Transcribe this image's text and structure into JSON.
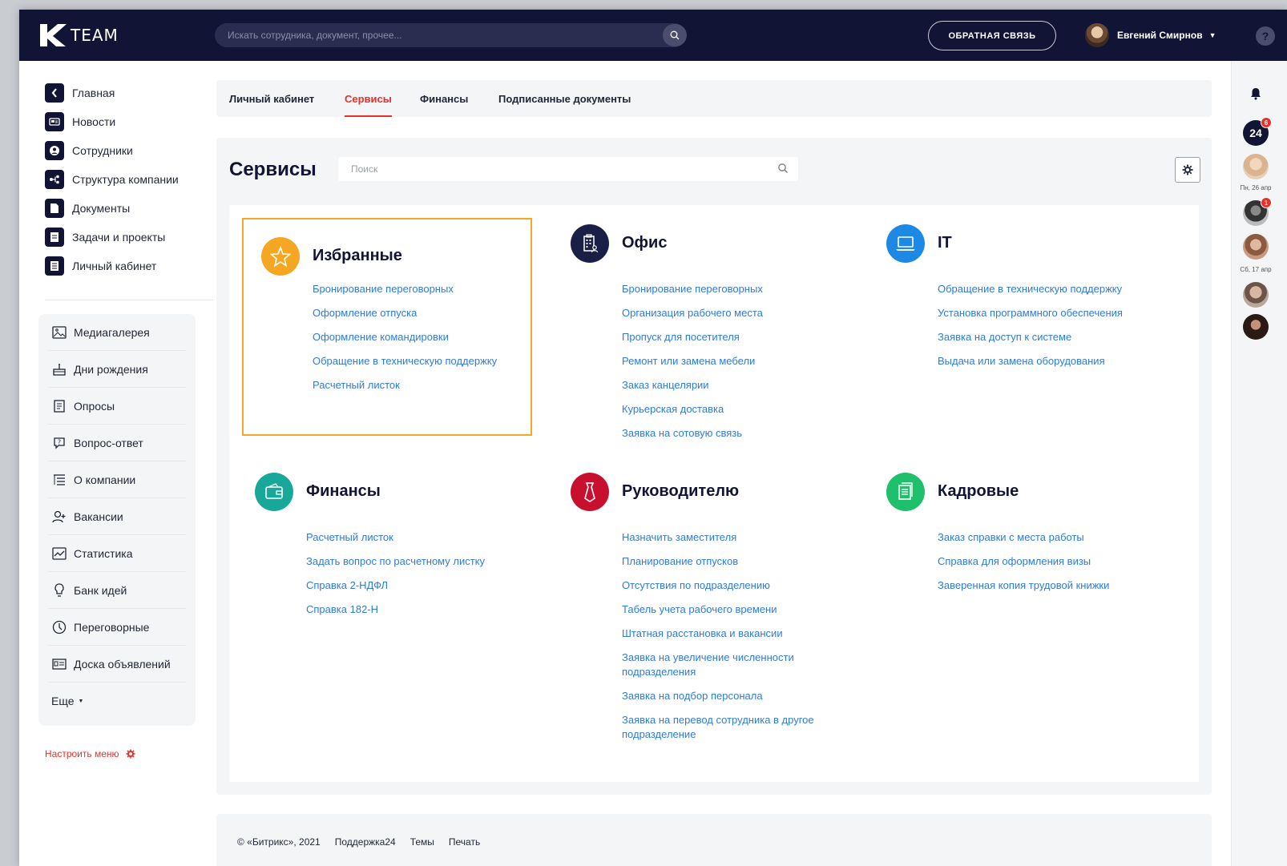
{
  "header": {
    "logo_text": "TEAM",
    "search_placeholder": "Искать сотрудника, документ, прочее...",
    "feedback_label": "ОБРАТНАЯ СВЯЗЬ",
    "user_name": "Евгений Смирнов",
    "help_label": "?"
  },
  "rail": {
    "bitrix_label": "24",
    "bitrix_badge": "6",
    "date1": "Пн, 26 апр",
    "avatar_badge": "1",
    "date2": "Сб, 17 апр"
  },
  "sidebar": {
    "main": [
      "Главная",
      "Новости",
      "Сотрудники",
      "Структура компании",
      "Документы",
      "Задачи и проекты",
      "Личный кабинет"
    ],
    "box": [
      "Медиагалерея",
      "Дни рождения",
      "Опросы",
      "Вопрос-ответ",
      "О компании",
      "Вакансии",
      "Статистика",
      "Банк идей",
      "Переговорные",
      "Доска объявлений"
    ],
    "more": "Еще",
    "customize": "Настроить меню"
  },
  "tabs": [
    "Личный кабинет",
    "Сервисы",
    "Финансы",
    "Подписанные документы"
  ],
  "services": {
    "title": "Сервисы",
    "search_placeholder": "Поиск",
    "categories": [
      {
        "title": "Избранные",
        "color": "#f5a623",
        "icon": "star-icon",
        "items": [
          "Бронирование переговорных",
          "Оформление отпуска",
          "Оформление командировки",
          "Обращение в техническую поддержку",
          "Расчетный листок"
        ]
      },
      {
        "title": "Офис",
        "color": "#1a1f45",
        "icon": "office-building-icon",
        "items": [
          "Бронирование переговорных",
          "Организация рабочего места",
          "Пропуск для посетителя",
          "Ремонт или замена мебели",
          "Заказ канцелярии",
          "Курьерская доставка",
          "Заявка на сотовую связь"
        ]
      },
      {
        "title": "IT",
        "color": "#1e88e5",
        "icon": "laptop-icon",
        "items": [
          "Обращение в техническую поддержку",
          "Установка программного обеспечения",
          "Заявка на доступ к системе",
          "Выдача или замена оборудования"
        ]
      },
      {
        "title": "Финансы",
        "color": "#17a89a",
        "icon": "wallet-icon",
        "items": [
          "Расчетный листок",
          "Задать вопрос по расчетному листку",
          "Справка 2-НДФЛ",
          "Справка 182-Н"
        ]
      },
      {
        "title": "Руководителю",
        "color": "#c8102e",
        "icon": "tie-icon",
        "items": [
          "Назначить заместителя",
          "Планирование отпусков",
          "Отсутствия по подразделению",
          "Табель учета рабочего времени",
          "Штатная расстановка и вакансии",
          "Заявка на увеличение численности подразделения",
          "Заявка на подбор персонала",
          "Заявка на перевод сотрудника в другое подразделение"
        ]
      },
      {
        "title": "Кадровые",
        "color": "#1ec06b",
        "icon": "document-icon",
        "items": [
          "Заказ справки с места работы",
          "Справка для оформления визы",
          "Заверенная копия трудовой книжки"
        ]
      }
    ]
  },
  "footer": {
    "copyright": "© «Битрикс», 2021",
    "support": "Поддержка24",
    "themes": "Темы",
    "print": "Печать"
  }
}
